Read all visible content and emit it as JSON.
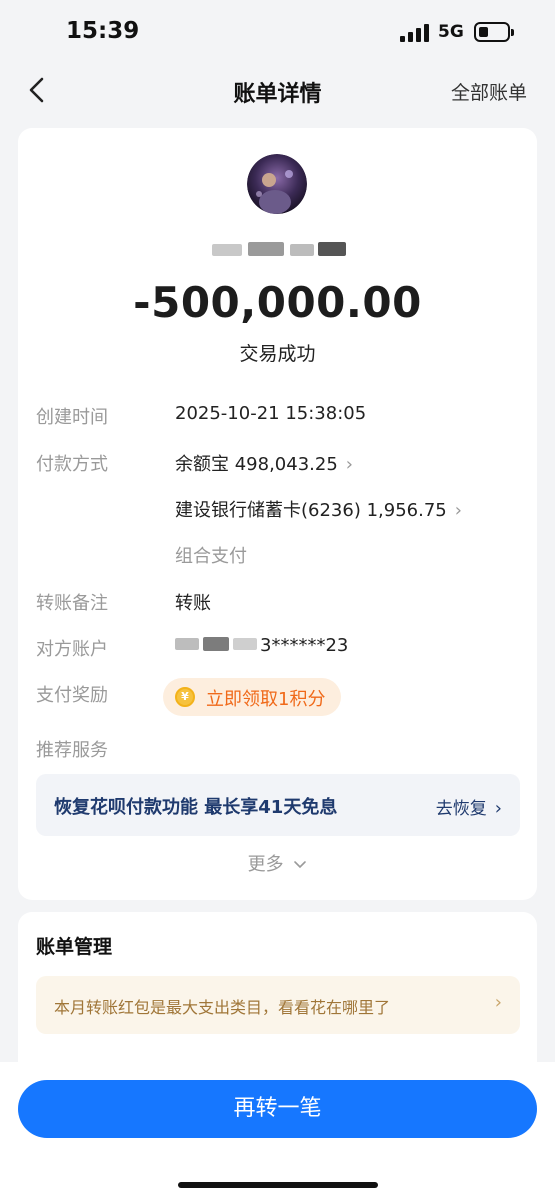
{
  "status_bar": {
    "time": "15:39",
    "network": "5G"
  },
  "nav": {
    "title": "账单详情",
    "right_link": "全部账单"
  },
  "transaction": {
    "amount": "-500,000.00",
    "status": "交易成功"
  },
  "details": [
    {
      "label": "创建时间",
      "value": "2025-10-21 15:38:05"
    },
    {
      "label": "付款方式",
      "value": "余额宝 498,043.25"
    },
    {
      "label": "",
      "value": "建设银行储蓄卡(6236) 1,956.75"
    },
    {
      "label": "",
      "value": "组合支付"
    },
    {
      "label": "转账备注",
      "value": "转账"
    },
    {
      "label": "对方账户",
      "value": "3******23"
    },
    {
      "label": "支付奖励",
      "value": ""
    },
    {
      "label": "推荐服务",
      "value": ""
    }
  ],
  "reward": {
    "text": "立即领取1积分",
    "icon": "coin-icon"
  },
  "promo": {
    "text": "恢复花呗付款功能 最长享41天免息",
    "action": "去恢复"
  },
  "more_label": "更多",
  "management": {
    "title": "账单管理",
    "tip": "本月转账红包是最大支出类目，看看花在哪里了"
  },
  "bottom_button": "再转一笔",
  "colors": {
    "primary": "#1677ff",
    "reward_orange": "#f06a1a",
    "promo_navy": "#1f3a6e"
  }
}
